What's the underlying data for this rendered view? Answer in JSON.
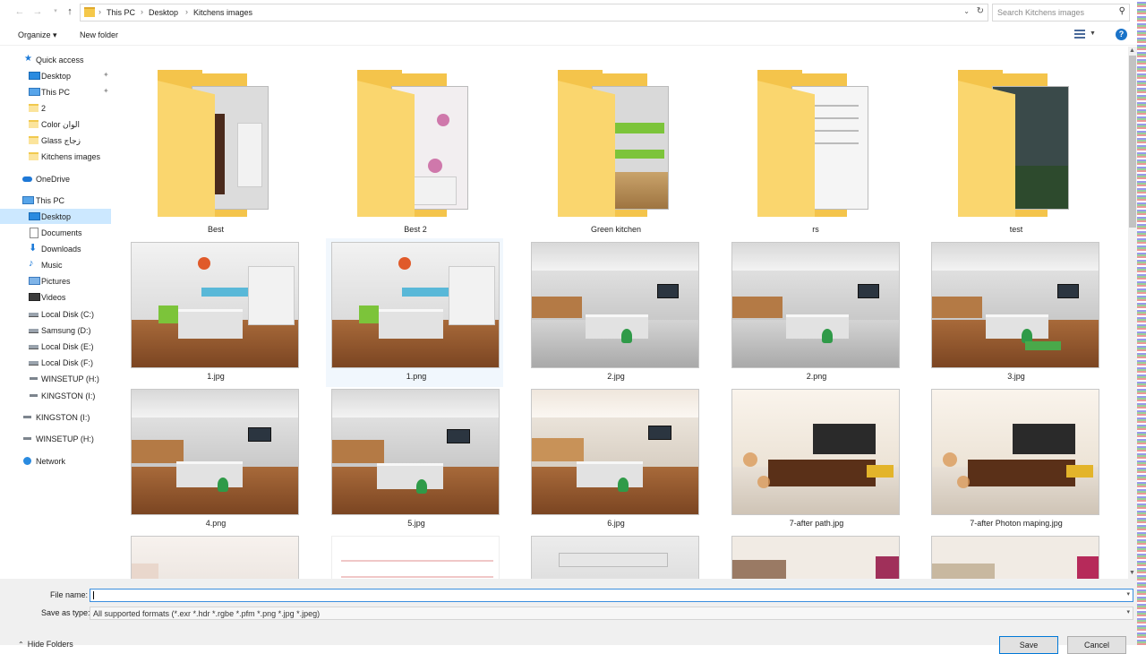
{
  "address_bar": {
    "crumbs": [
      "This PC",
      "Desktop",
      "Kitchens images"
    ],
    "search_placeholder": "Search Kitchens images"
  },
  "command_bar": {
    "organize_label": "Organize ▾",
    "new_folder_label": "New folder"
  },
  "nav": {
    "items": [
      {
        "label": "Quick access",
        "icon": "star-icon"
      },
      {
        "label": "Desktop",
        "icon": "desktop-icon"
      },
      {
        "label": "This PC",
        "icon": "pc-icon"
      },
      {
        "label": "2",
        "icon": "folder-icon"
      },
      {
        "label": "Color الوان",
        "icon": "folder-icon"
      },
      {
        "label": "Glass زجاج",
        "icon": "folder-icon"
      },
      {
        "label": "Kitchens images",
        "icon": "folder-icon"
      },
      {
        "label": "OneDrive",
        "icon": "cloud-icon"
      },
      {
        "label": "This PC",
        "icon": "pc-icon"
      },
      {
        "label": "Desktop",
        "icon": "desktop-icon"
      },
      {
        "label": "Documents",
        "icon": "documents-icon"
      },
      {
        "label": "Downloads",
        "icon": "downloads-icon"
      },
      {
        "label": "Music",
        "icon": "music-icon"
      },
      {
        "label": "Pictures",
        "icon": "pictures-icon"
      },
      {
        "label": "Videos",
        "icon": "videos-icon"
      },
      {
        "label": "Local Disk (C:)",
        "icon": "drive-icon"
      },
      {
        "label": "Samsung (D:)",
        "icon": "drive-icon"
      },
      {
        "label": "Local Disk (E:)",
        "icon": "drive-icon"
      },
      {
        "label": "Local Disk (F:)",
        "icon": "drive-icon"
      },
      {
        "label": "WINSETUP (H:)",
        "icon": "usb-drive-icon"
      },
      {
        "label": "KINGSTON (I:)",
        "icon": "usb-drive-icon"
      },
      {
        "label": "KINGSTON (I:)",
        "icon": "usb-drive-icon"
      },
      {
        "label": "WINSETUP (H:)",
        "icon": "usb-drive-icon"
      },
      {
        "label": "Network",
        "icon": "network-icon"
      }
    ]
  },
  "files": [
    {
      "name": "Best",
      "kind": "folder"
    },
    {
      "name": "Best 2",
      "kind": "folder"
    },
    {
      "name": "Green kitchen",
      "kind": "folder"
    },
    {
      "name": "rs",
      "kind": "folder"
    },
    {
      "name": "test",
      "kind": "folder"
    },
    {
      "name": "1.jpg",
      "kind": "image"
    },
    {
      "name": "1.png",
      "kind": "image"
    },
    {
      "name": "2.jpg",
      "kind": "image"
    },
    {
      "name": "2.png",
      "kind": "image"
    },
    {
      "name": "3.jpg",
      "kind": "image"
    },
    {
      "name": "4.png",
      "kind": "image"
    },
    {
      "name": "5.jpg",
      "kind": "image"
    },
    {
      "name": "6.jpg",
      "kind": "image"
    },
    {
      "name": "7-after path.jpg",
      "kind": "image"
    },
    {
      "name": "7-after Photon maping.jpg",
      "kind": "image"
    }
  ],
  "save_form": {
    "file_name_label": "File name:",
    "file_name_value": "",
    "save_as_type_label": "Save as type:",
    "save_as_type_value": "All supported formats (*.exr *.hdr *.rgbe *.pfm *.png *.jpg *.jpeg)",
    "hide_folders_label": "Hide Folders",
    "save_label": "Save",
    "cancel_label": "Cancel"
  }
}
